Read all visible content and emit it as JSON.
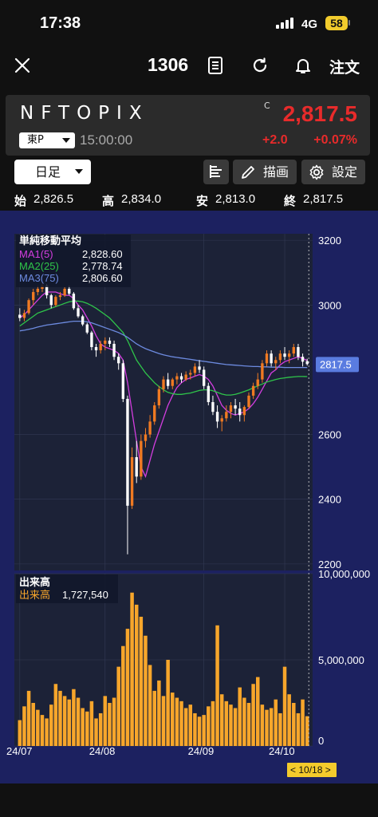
{
  "status_bar": {
    "time": "17:38",
    "network": "4G",
    "battery": "58"
  },
  "nav": {
    "close_icon": "close-icon",
    "code": "1306",
    "order_label": "注文"
  },
  "quote": {
    "name": "NFTOPIX",
    "exchange": "東P",
    "time": "15:00:00",
    "flag": "C",
    "price": "2,817.5",
    "change": "+2.0",
    "change_pct": "+0.07%",
    "price_color": "#e82b2b"
  },
  "toolbar": {
    "period": "日足",
    "draw_label": "描画",
    "settings_label": "設定"
  },
  "ohlc": {
    "open_label": "始",
    "open": "2,826.5",
    "high_label": "高",
    "high": "2,834.0",
    "low_label": "安",
    "low": "2,813.0",
    "close_label": "終",
    "close": "2,817.5"
  },
  "ma_legend": {
    "title": "単純移動平均",
    "items": [
      {
        "label": "MA1(5)",
        "value": "2,828.60",
        "color": "#d43ee0"
      },
      {
        "label": "MA2(25)",
        "value": "2,778.74",
        "color": "#2fc54a"
      },
      {
        "label": "MA3(75)",
        "value": "2,806.60",
        "color": "#6d8be0"
      }
    ]
  },
  "volume_legend": {
    "title": "出来高",
    "label": "出来高",
    "value": "1,727,540",
    "color": "#f7a62b"
  },
  "chart_data": [
    {
      "type": "candlestick",
      "y_ticks": [
        "3200",
        "3000",
        "2600",
        "2400",
        "2200"
      ],
      "ylim": [
        2180,
        3220
      ],
      "x_ticks": [
        "24/07",
        "24/08",
        "24/09",
        "24/10"
      ],
      "last_price_label": "2817.5",
      "up_color": "#f07a22",
      "down_color": "#ffffff",
      "ohlc": [
        [
          2970,
          2990,
          2950,
          2960
        ],
        [
          2960,
          2985,
          2950,
          2975
        ],
        [
          2975,
          3020,
          2970,
          3015
        ],
        [
          3015,
          3050,
          3000,
          3040
        ],
        [
          3040,
          3060,
          3030,
          3050
        ],
        [
          3050,
          3070,
          3040,
          3060
        ],
        [
          3060,
          3065,
          3020,
          3030
        ],
        [
          3030,
          3035,
          2990,
          3000
        ],
        [
          3000,
          3030,
          2995,
          3025
        ],
        [
          3025,
          3040,
          3015,
          3030
        ],
        [
          3030,
          3055,
          3025,
          3050
        ],
        [
          3050,
          3060,
          3030,
          3035
        ],
        [
          3035,
          3040,
          2985,
          2990
        ],
        [
          2990,
          3000,
          2960,
          2965
        ],
        [
          2965,
          2970,
          2935,
          2940
        ],
        [
          2940,
          2945,
          2910,
          2915
        ],
        [
          2915,
          2920,
          2860,
          2870
        ],
        [
          2870,
          2880,
          2840,
          2860
        ],
        [
          2860,
          2890,
          2850,
          2880
        ],
        [
          2880,
          2900,
          2860,
          2890
        ],
        [
          2890,
          2900,
          2870,
          2880
        ],
        [
          2880,
          2890,
          2830,
          2840
        ],
        [
          2840,
          2850,
          2800,
          2820
        ],
        [
          2820,
          2830,
          2700,
          2710
        ],
        [
          2710,
          2720,
          2230,
          2380
        ],
        [
          2380,
          2560,
          2370,
          2530
        ],
        [
          2530,
          2580,
          2450,
          2470
        ],
        [
          2470,
          2600,
          2460,
          2580
        ],
        [
          2580,
          2620,
          2560,
          2600
        ],
        [
          2600,
          2660,
          2590,
          2640
        ],
        [
          2640,
          2700,
          2630,
          2690
        ],
        [
          2690,
          2750,
          2680,
          2740
        ],
        [
          2740,
          2780,
          2730,
          2770
        ],
        [
          2770,
          2790,
          2740,
          2750
        ],
        [
          2750,
          2775,
          2740,
          2770
        ],
        [
          2770,
          2790,
          2755,
          2780
        ],
        [
          2780,
          2790,
          2760,
          2770
        ],
        [
          2770,
          2795,
          2765,
          2785
        ],
        [
          2785,
          2800,
          2770,
          2790
        ],
        [
          2790,
          2820,
          2780,
          2810
        ],
        [
          2810,
          2830,
          2790,
          2800
        ],
        [
          2800,
          2810,
          2740,
          2750
        ],
        [
          2750,
          2760,
          2690,
          2700
        ],
        [
          2700,
          2720,
          2660,
          2670
        ],
        [
          2670,
          2690,
          2620,
          2640
        ],
        [
          2640,
          2660,
          2610,
          2650
        ],
        [
          2650,
          2690,
          2640,
          2670
        ],
        [
          2670,
          2700,
          2650,
          2690
        ],
        [
          2690,
          2710,
          2660,
          2680
        ],
        [
          2680,
          2700,
          2640,
          2660
        ],
        [
          2660,
          2690,
          2640,
          2685
        ],
        [
          2685,
          2730,
          2680,
          2720
        ],
        [
          2720,
          2760,
          2710,
          2750
        ],
        [
          2750,
          2790,
          2740,
          2770
        ],
        [
          2770,
          2830,
          2760,
          2820
        ],
        [
          2820,
          2860,
          2810,
          2850
        ],
        [
          2850,
          2860,
          2810,
          2820
        ],
        [
          2820,
          2840,
          2800,
          2830
        ],
        [
          2830,
          2860,
          2820,
          2850
        ],
        [
          2850,
          2870,
          2830,
          2840
        ],
        [
          2840,
          2860,
          2820,
          2850
        ],
        [
          2850,
          2880,
          2840,
          2870
        ],
        [
          2870,
          2880,
          2830,
          2840
        ],
        [
          2840,
          2850,
          2810,
          2825
        ],
        [
          2826.5,
          2834,
          2813,
          2817.5
        ]
      ],
      "ma": [
        {
          "name": "MA1(5)",
          "values": [
            2960,
            2970,
            2985,
            3000,
            3015,
            3030,
            3040,
            3040,
            3040,
            3035,
            3030,
            3030,
            3020,
            3000,
            2985,
            2960,
            2935,
            2905,
            2880,
            2870,
            2865,
            2860,
            2850,
            2830,
            2760,
            2670,
            2580,
            2500,
            2470,
            2520,
            2570,
            2610,
            2650,
            2690,
            2720,
            2745,
            2760,
            2770,
            2775,
            2780,
            2785,
            2780,
            2770,
            2750,
            2720,
            2690,
            2675,
            2665,
            2660,
            2665,
            2670,
            2680,
            2695,
            2715,
            2740,
            2765,
            2790,
            2800,
            2815,
            2825,
            2830,
            2835,
            2840,
            2835,
            2828.6
          ]
        },
        {
          "name": "MA2(25)",
          "values": [
            2935,
            2945,
            2955,
            2965,
            2975,
            2980,
            2985,
            2990,
            2995,
            3000,
            3005,
            3010,
            3012,
            3012,
            3010,
            3005,
            2998,
            2990,
            2980,
            2970,
            2960,
            2945,
            2930,
            2915,
            2890,
            2860,
            2830,
            2810,
            2790,
            2775,
            2760,
            2748,
            2738,
            2730,
            2726,
            2724,
            2724,
            2726,
            2728,
            2732,
            2736,
            2738,
            2738,
            2735,
            2730,
            2725,
            2722,
            2722,
            2724,
            2728,
            2733,
            2738,
            2744,
            2750,
            2756,
            2762,
            2766,
            2770,
            2773,
            2775,
            2777,
            2778,
            2779,
            2779,
            2778.74
          ]
        },
        {
          "name": "MA3(75)",
          "values": [
            2920,
            2922,
            2925,
            2928,
            2932,
            2935,
            2938,
            2940,
            2942,
            2944,
            2946,
            2948,
            2950,
            2950,
            2950,
            2948,
            2945,
            2940,
            2935,
            2930,
            2925,
            2920,
            2915,
            2908,
            2900,
            2890,
            2880,
            2872,
            2865,
            2860,
            2855,
            2850,
            2846,
            2843,
            2840,
            2838,
            2836,
            2834,
            2832,
            2830,
            2828,
            2826,
            2824,
            2822,
            2820,
            2818,
            2816,
            2815,
            2814,
            2813,
            2812,
            2811,
            2810,
            2810,
            2809,
            2809,
            2808,
            2808,
            2808,
            2807,
            2807,
            2807,
            2807,
            2807,
            2806.6
          ]
        }
      ]
    },
    {
      "type": "bar",
      "title": "出来高",
      "y_ticks": [
        "10,000,000",
        "5,000,000",
        "0"
      ],
      "ylim": [
        0,
        10000000
      ],
      "values": [
        1500000,
        2300000,
        3200000,
        2500000,
        2100000,
        1800000,
        1600000,
        2400000,
        3600000,
        3200000,
        2900000,
        2700000,
        3300000,
        2800000,
        2200000,
        2000000,
        2600000,
        1600000,
        1900000,
        2900000,
        2500000,
        2800000,
        4600000,
        5800000,
        6800000,
        8900000,
        8200000,
        7500000,
        6400000,
        4700000,
        3200000,
        3800000,
        2900000,
        5000000,
        3100000,
        2800000,
        2600000,
        2200000,
        2400000,
        1900000,
        1700000,
        1800000,
        2300000,
        2600000,
        7000000,
        3000000,
        2600000,
        2400000,
        2200000,
        3400000,
        2800000,
        2500000,
        3600000,
        4000000,
        2400000,
        2100000,
        2200000,
        2700000,
        1900000,
        4600000,
        3000000,
        2500000,
        1900000,
        2700000,
        1727540
      ]
    }
  ],
  "date_indicator": "< 10/18 >"
}
